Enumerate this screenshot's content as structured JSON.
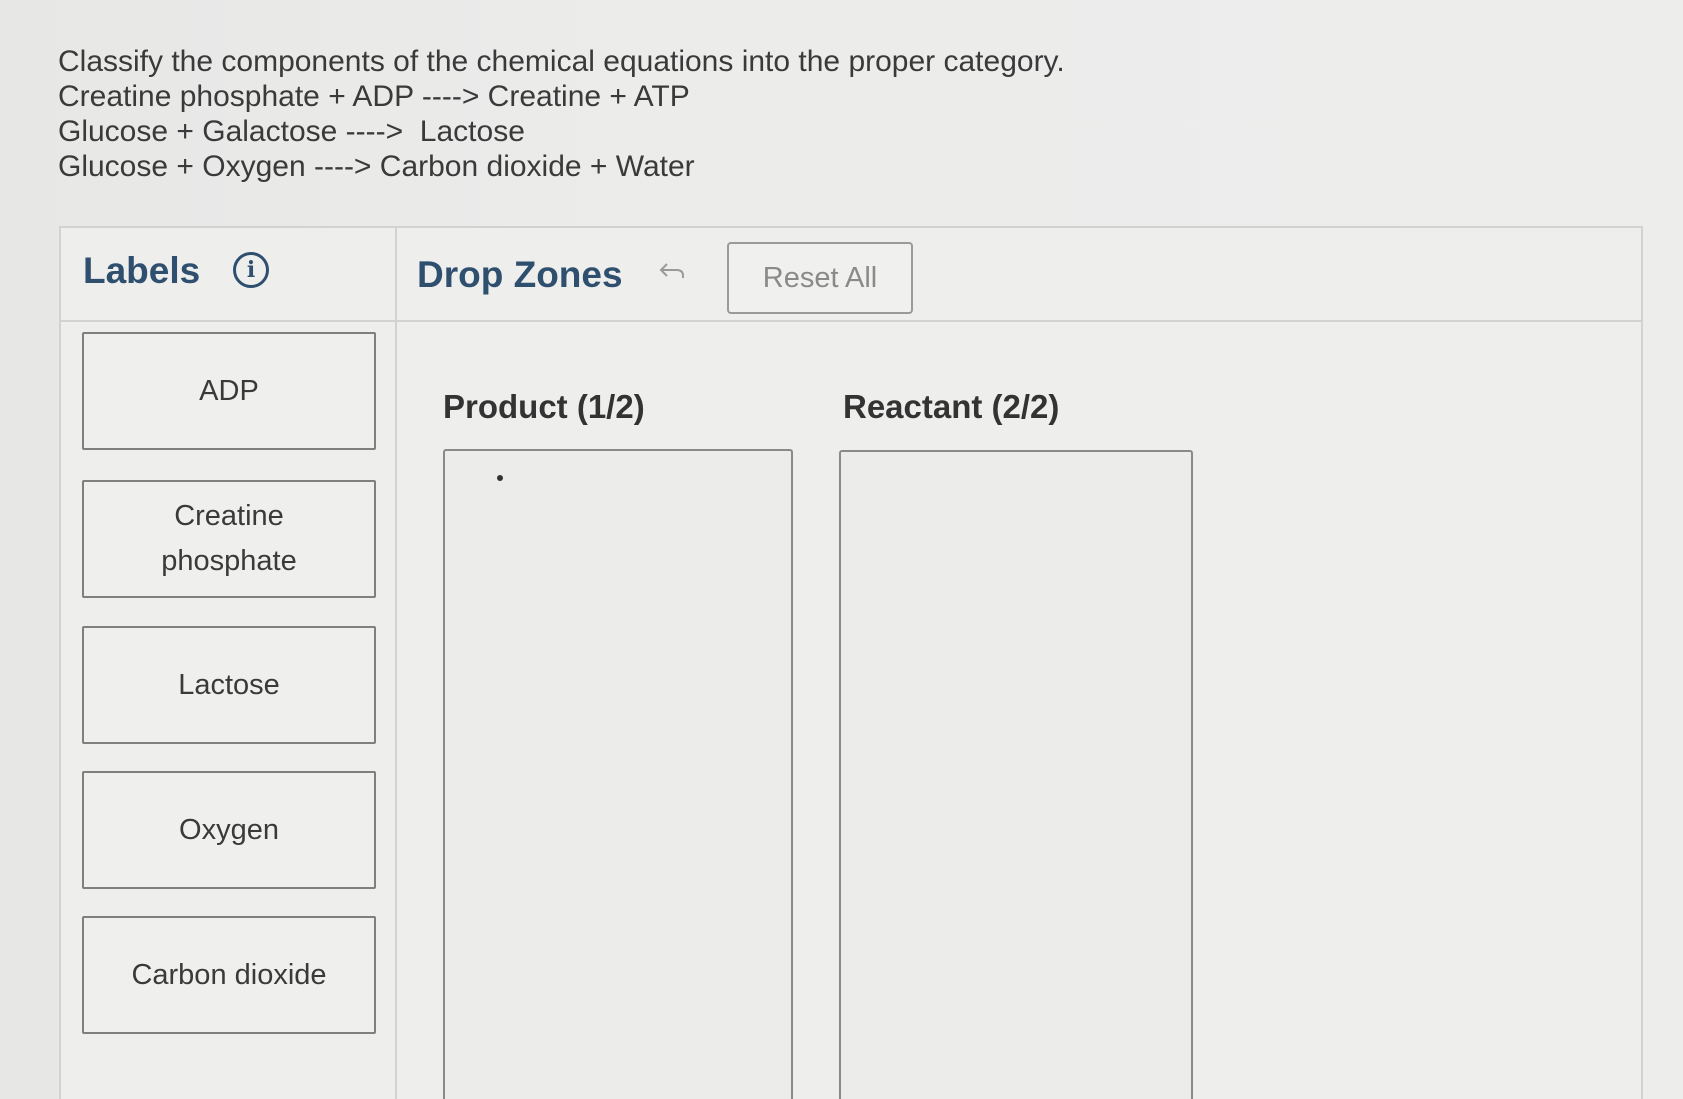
{
  "question": {
    "lines": [
      "Classify the components of the chemical equations into the proper category.",
      "Creatine phosphate + ADP ----> Creatine + ATP",
      "Glucose + Galactose ---->  Lactose",
      "Glucose + Oxygen ----> Carbon dioxide + Water"
    ]
  },
  "labels_panel": {
    "title": "Labels",
    "info_icon": "info-icon",
    "cards": [
      "ADP",
      "Creatine phosphate",
      "Lactose",
      "Oxygen",
      "Carbon dioxide"
    ]
  },
  "drop_zones_panel": {
    "title": "Drop Zones",
    "undo_icon": "undo-icon",
    "reset_label": "Reset All",
    "zones": [
      {
        "title": "Product (1/2)"
      },
      {
        "title": "Reactant (2/2)"
      }
    ]
  }
}
